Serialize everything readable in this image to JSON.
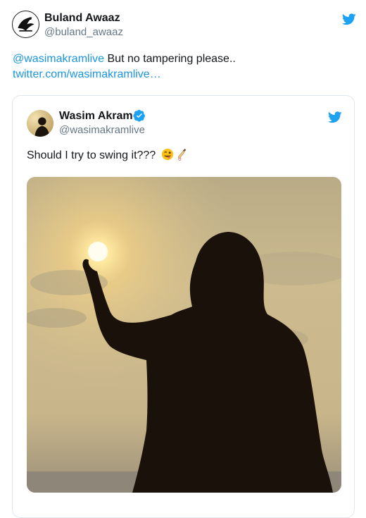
{
  "tweet": {
    "author_name": "Buland Awaaz",
    "author_handle": "@buland_awaaz",
    "mention": "@wasimakramlive",
    "text": " But no tampering please..",
    "link_text": "twitter.com/wasimakramlive…"
  },
  "quoted_tweet": {
    "author_name": "Wasim Akram",
    "author_handle": "@wasimakramlive",
    "verified": true,
    "text": "Should I try to swing it???",
    "emojis": [
      "winking-face-with-tongue",
      "cricket-bat"
    ]
  },
  "colors": {
    "link": "#1b95e0",
    "twitter_blue": "#1da1f2",
    "secondary_text": "#657786",
    "card_border": "#e1e8ed"
  },
  "icons": [
    "twitter-bird-icon",
    "verified-badge-icon"
  ]
}
